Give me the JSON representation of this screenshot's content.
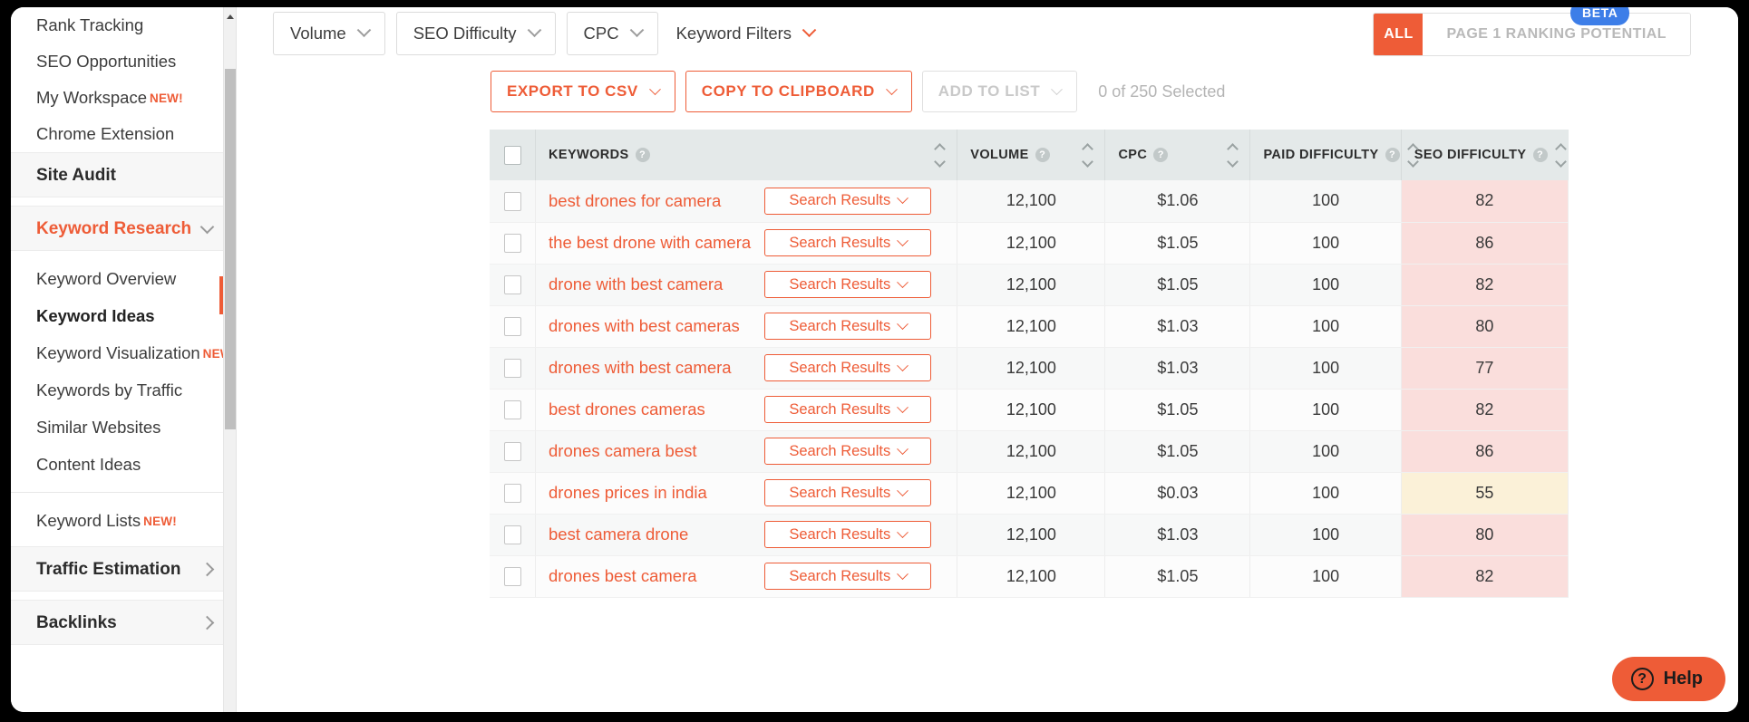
{
  "sidebar": {
    "top_links": [
      {
        "label": "Rank Tracking",
        "badge": ""
      },
      {
        "label": "SEO Opportunities",
        "badge": ""
      },
      {
        "label": "My Workspace",
        "badge": "NEW!"
      },
      {
        "label": "Chrome Extension",
        "badge": ""
      }
    ],
    "site_audit": {
      "label": "Site Audit"
    },
    "keyword_research": {
      "label": "Keyword Research",
      "expanded": true
    },
    "keyword_research_items": [
      {
        "label": "Keyword Overview",
        "badge": "",
        "current": false
      },
      {
        "label": "Keyword Ideas",
        "badge": "",
        "current": true
      },
      {
        "label": "Keyword Visualization",
        "badge": "NEW!",
        "current": false
      },
      {
        "label": "Keywords by Traffic",
        "badge": "",
        "current": false
      },
      {
        "label": "Similar Websites",
        "badge": "",
        "current": false
      },
      {
        "label": "Content Ideas",
        "badge": "",
        "current": false
      }
    ],
    "keyword_lists": {
      "label": "Keyword Lists",
      "badge": "NEW!"
    },
    "traffic_estimation": {
      "label": "Traffic Estimation"
    },
    "backlinks": {
      "label": "Backlinks"
    }
  },
  "filters": [
    {
      "label": "Volume",
      "bordered": true
    },
    {
      "label": "SEO Difficulty",
      "bordered": true
    },
    {
      "label": "CPC",
      "bordered": true
    },
    {
      "label": "Keyword Filters",
      "bordered": false
    }
  ],
  "view_toggle": {
    "beta_badge": "BETA",
    "all_label": "ALL",
    "page1_label": "PAGE 1 RANKING POTENTIAL",
    "active": "ALL"
  },
  "actions": {
    "export_csv": "EXPORT TO CSV",
    "copy_clipboard": "COPY TO CLIPBOARD",
    "add_to_list": "ADD TO LIST",
    "selected_count": "0 of 250 Selected"
  },
  "table": {
    "columns": [
      {
        "key": "keywords",
        "label": "KEYWORDS",
        "help": "?"
      },
      {
        "key": "volume",
        "label": "VOLUME",
        "help": "?"
      },
      {
        "key": "cpc",
        "label": "CPC",
        "help": "?"
      },
      {
        "key": "paid_difficulty",
        "label": "PAID DIFFICULTY",
        "help": "?"
      },
      {
        "key": "seo_difficulty",
        "label": "SEO DIFFICULTY",
        "help": "?"
      }
    ],
    "search_results_label": "Search Results",
    "rows": [
      {
        "keyword": "best drones for camera",
        "volume": "12,100",
        "cpc": "$1.06",
        "paid_difficulty": "100",
        "seo_difficulty": "82",
        "sd_level": "red"
      },
      {
        "keyword": "the best drone with camera",
        "volume": "12,100",
        "cpc": "$1.05",
        "paid_difficulty": "100",
        "seo_difficulty": "86",
        "sd_level": "red"
      },
      {
        "keyword": "drone with best camera",
        "volume": "12,100",
        "cpc": "$1.05",
        "paid_difficulty": "100",
        "seo_difficulty": "82",
        "sd_level": "red"
      },
      {
        "keyword": "drones with best cameras",
        "volume": "12,100",
        "cpc": "$1.03",
        "paid_difficulty": "100",
        "seo_difficulty": "80",
        "sd_level": "red"
      },
      {
        "keyword": "drones with best camera",
        "volume": "12,100",
        "cpc": "$1.03",
        "paid_difficulty": "100",
        "seo_difficulty": "77",
        "sd_level": "red"
      },
      {
        "keyword": "best drones cameras",
        "volume": "12,100",
        "cpc": "$1.05",
        "paid_difficulty": "100",
        "seo_difficulty": "82",
        "sd_level": "red"
      },
      {
        "keyword": "drones camera best",
        "volume": "12,100",
        "cpc": "$1.05",
        "paid_difficulty": "100",
        "seo_difficulty": "86",
        "sd_level": "red"
      },
      {
        "keyword": "drones prices in india",
        "volume": "12,100",
        "cpc": "$0.03",
        "paid_difficulty": "100",
        "seo_difficulty": "55",
        "sd_level": "yellow"
      },
      {
        "keyword": "best camera drone",
        "volume": "12,100",
        "cpc": "$1.03",
        "paid_difficulty": "100",
        "seo_difficulty": "80",
        "sd_level": "red"
      },
      {
        "keyword": "drones best camera",
        "volume": "12,100",
        "cpc": "$1.05",
        "paid_difficulty": "100",
        "seo_difficulty": "82",
        "sd_level": "red"
      }
    ]
  },
  "help_widget": {
    "label": "Help"
  },
  "colors": {
    "accent": "#ee5c37",
    "beta_blue": "#3d7ee8",
    "header_bg": "#e4e9e9",
    "sd_red": "#fadedc",
    "sd_yellow": "#fbf1d8"
  }
}
